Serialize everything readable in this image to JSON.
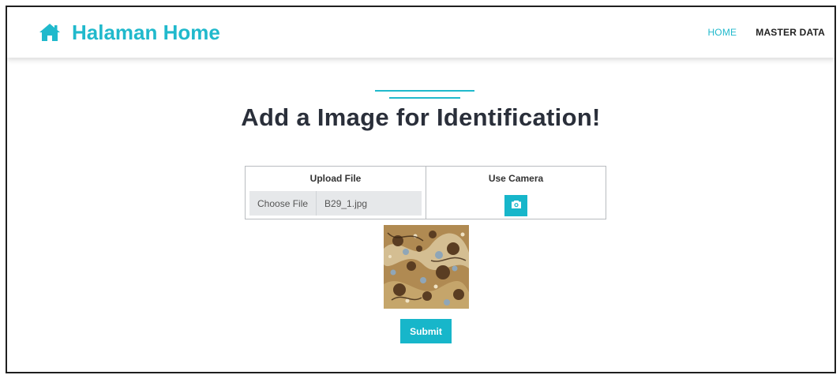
{
  "navbar": {
    "brand_icon": "home-icon",
    "brand_title": "Halaman Home",
    "links": [
      {
        "label": "HOME",
        "active": true
      },
      {
        "label": "MASTER DATA",
        "active": false
      }
    ],
    "accent_color": "#20b9cc"
  },
  "main": {
    "heading": "Add a Image for Identification!",
    "upload": {
      "title": "Upload File",
      "choose_label": "Choose File",
      "file_name": "B29_1.jpg"
    },
    "camera": {
      "title": "Use Camera",
      "icon": "camera-icon"
    },
    "preview_image": "batik-pattern-preview",
    "submit_label": "Submit"
  }
}
